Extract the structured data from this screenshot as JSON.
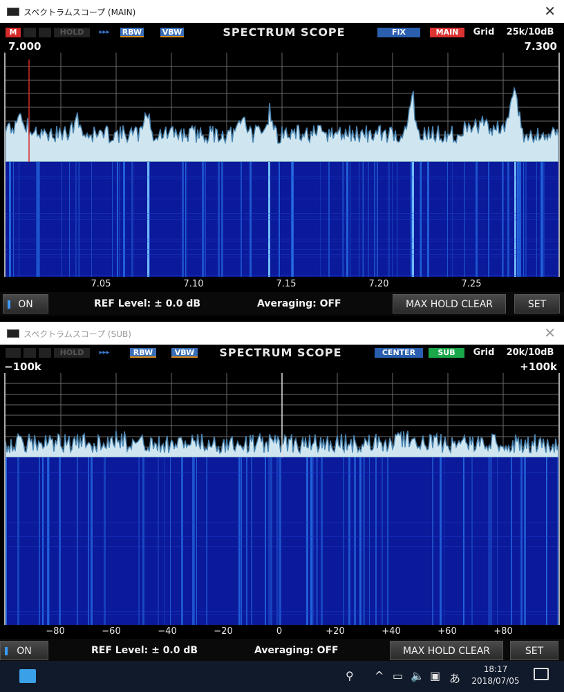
{
  "main_window": {
    "title": "スペクトラムスコープ (MAIN)",
    "close": "✕",
    "header": {
      "m_badge": "M",
      "hold": "HOLD",
      "arrows": "▸▸▸",
      "rbw": "RBW",
      "vbw": "VBW",
      "title": "SPECTRUM SCOPE",
      "mode": "FIX",
      "receiver": "MAIN",
      "grid_label": "Grid",
      "grid_value": "25k/10dB"
    },
    "edge_left": "7.000",
    "edge_right": "7.300",
    "ticks": [
      "7.05",
      "7.10",
      "7.15",
      "7.20",
      "7.25"
    ],
    "controls": {
      "on": "ON",
      "ref_level": "REF Level: ± 0.0 dB",
      "averaging": "Averaging: OFF",
      "max_hold_clear": "MAX HOLD CLEAR",
      "set": "SET"
    }
  },
  "sub_window": {
    "title": "スペクトラムスコープ (SUB)",
    "close": "✕",
    "header": {
      "m_badge": "",
      "hold": "HOLD",
      "arrows": "▸▸▸",
      "rbw": "RBW",
      "vbw": "VBW",
      "title": "SPECTRUM SCOPE",
      "mode": "CENTER",
      "receiver": "SUB",
      "grid_label": "Grid",
      "grid_value": "20k/10dB"
    },
    "edge_left": "−100k",
    "edge_right": "+100k",
    "ticks": [
      "−80",
      "−60",
      "−40",
      "−20",
      "0",
      "+20",
      "+40",
      "+60",
      "+80"
    ],
    "controls": {
      "on": "ON",
      "ref_level": "REF Level: ± 0.0 dB",
      "averaging": "Averaging: OFF",
      "max_hold_clear": "MAX HOLD CLEAR",
      "set": "SET"
    }
  },
  "taskbar": {
    "time": "18:17",
    "date": "2018/07/05",
    "ime": "あ"
  },
  "colors": {
    "waterfall": "#0a1a9a",
    "waterfall_line": "#2a7af0",
    "spectrum_fill": "#cfe6f0",
    "spectrum_edge": "#4a84b0",
    "marker": "#d42a2a"
  }
}
